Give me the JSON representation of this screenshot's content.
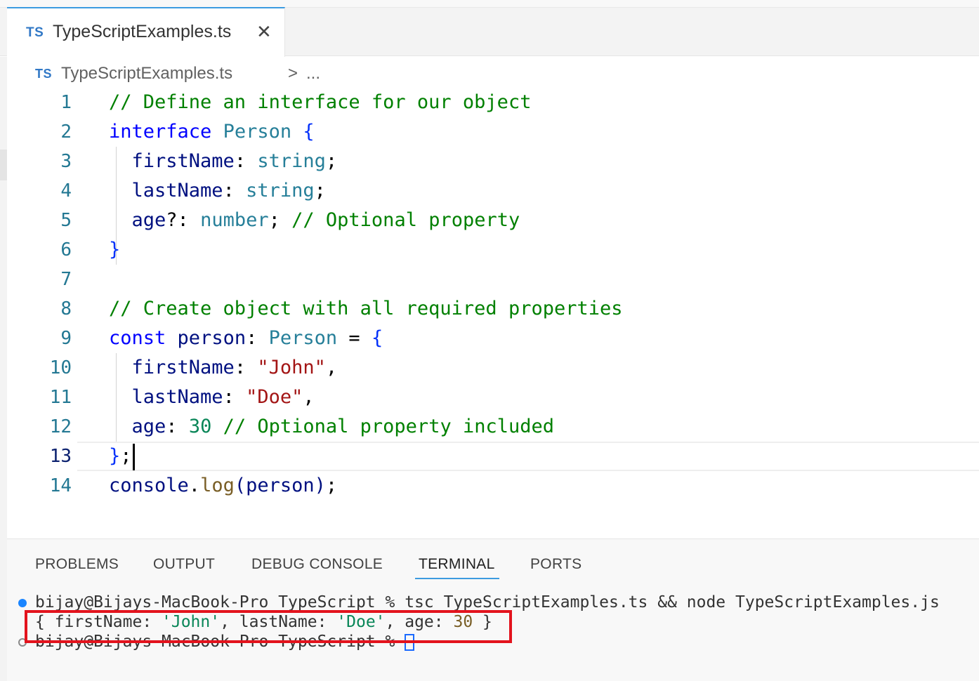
{
  "tab": {
    "badge": "TS",
    "title": "TypeScriptExamples.ts",
    "close": "✕"
  },
  "breadcrumb": {
    "badge": "TS",
    "file": "TypeScriptExamples.ts",
    "separator": ">",
    "more": "..."
  },
  "editor": {
    "active_line": 13,
    "line_numbers": [
      "1",
      "2",
      "3",
      "4",
      "5",
      "6",
      "7",
      "8",
      "9",
      "10",
      "11",
      "12",
      "13",
      "14"
    ],
    "lines": [
      "// Define an interface for our object",
      "interface Person {",
      "  firstName: string;",
      "  lastName: string;",
      "  age?: number; // Optional property",
      "}",
      "",
      "// Create object with all required properties",
      "const person: Person = {",
      "  firstName: \"John\",",
      "  lastName: \"Doe\",",
      "  age: 30 // Optional property included",
      "};",
      "console.log(person);"
    ]
  },
  "panel": {
    "tabs": [
      "PROBLEMS",
      "OUTPUT",
      "DEBUG CONSOLE",
      "TERMINAL",
      "PORTS"
    ],
    "active_tab": "TERMINAL",
    "terminal": {
      "command_line": "bijay@Bijays-MacBook-Pro TypeScript % tsc TypeScriptExamples.ts && node TypeScriptExamples.js",
      "output_line": "{ firstName: 'John', lastName: 'Doe', age: 30 }",
      "prompt_line": "bijay@Bijays-MacBook-Pro TypeScript % "
    }
  },
  "colors": {
    "comment": "#008000",
    "keyword": "#0000ff",
    "type": "#267f99",
    "variable": "#001080",
    "string": "#a31515",
    "number": "#098658",
    "function": "#795e26",
    "accent": "#3c9be0",
    "highlight_box": "#e3131d"
  }
}
